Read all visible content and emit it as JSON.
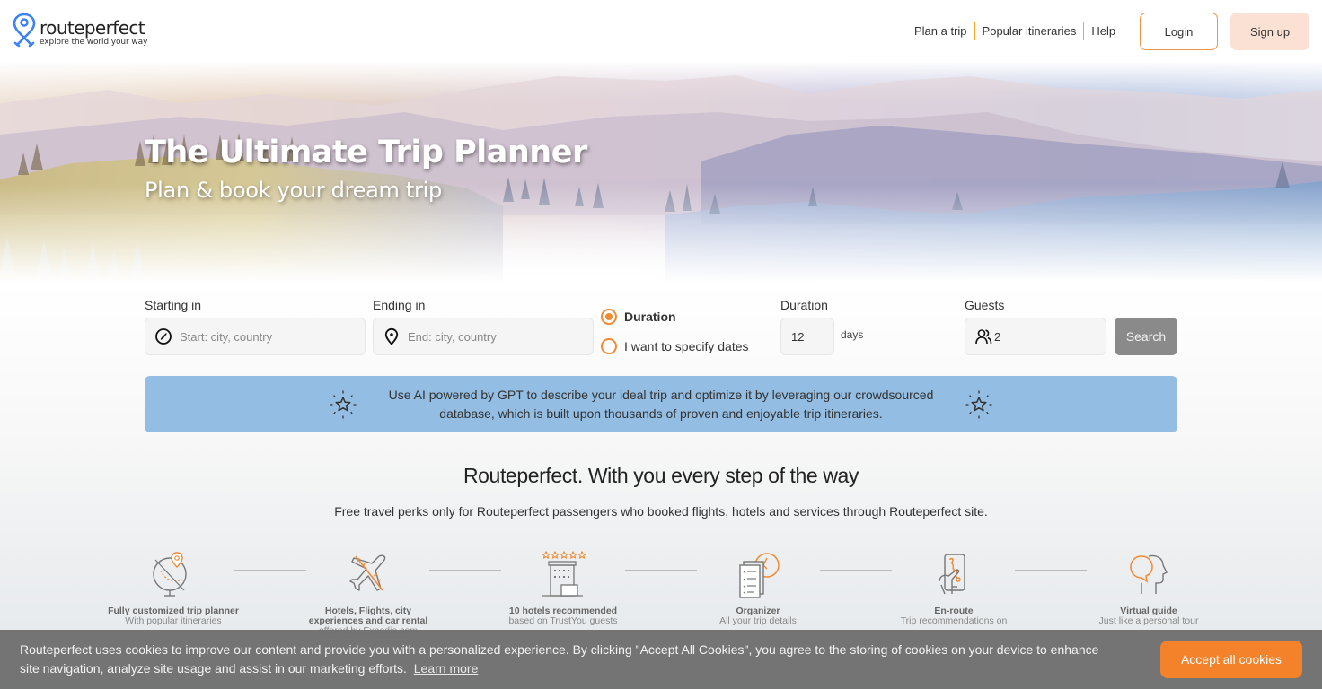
{
  "header": {
    "logo_name": "routeperfect",
    "logo_tagline": "explore the world your way",
    "nav": [
      {
        "label": "Plan a trip"
      },
      {
        "label": "Popular itineraries"
      },
      {
        "label": "Help"
      }
    ],
    "login_label": "Login",
    "signup_label": "Sign up"
  },
  "hero": {
    "title": "The Ultimate Trip Planner",
    "subtitle": "Plan & book your dream trip"
  },
  "search": {
    "start": {
      "label": "Starting in",
      "placeholder": "Start: city, country",
      "value": "",
      "icon": "compass-icon"
    },
    "end": {
      "label": "Ending in",
      "placeholder": "End: city, country",
      "value": "",
      "icon": "map-pin-icon"
    },
    "mode_options": [
      {
        "label": "Duration",
        "selected": true
      },
      {
        "label": "I want to specify dates",
        "selected": false
      }
    ],
    "duration": {
      "label": "Duration",
      "value": "12",
      "unit": "days"
    },
    "guests": {
      "label": "Guests",
      "value": "2",
      "icon": "users-icon"
    },
    "search_label": "Search"
  },
  "ai_banner": {
    "text": "Use AI powered by GPT to describe your ideal trip and optimize it by leveraging our crowdsourced database, which is built upon thousands of proven and enjoyable trip itineraries.",
    "icon": "sparkle-star-icon"
  },
  "perks": {
    "title": "Routeperfect. With you every step of the way",
    "subtitle": "Free travel perks only for Routeperfect passengers who booked flights, hotels and services through Routeperfect site.",
    "items": [
      {
        "icon": "globe-planner-icon",
        "title": "Fully customized trip planner",
        "desc": "With popular itineraries"
      },
      {
        "icon": "airplane-icon",
        "title": "Hotels, Flights, city experiences and car rental",
        "desc": "offered by Expedia.com"
      },
      {
        "icon": "hotel-icon",
        "title": "10 hotels recommended",
        "desc": "based on TrustYou guests"
      },
      {
        "icon": "organizer-icon",
        "title": "Organizer",
        "desc": "All your trip details"
      },
      {
        "icon": "phone-route-icon",
        "title": "En-route",
        "desc": "Trip recommendations on"
      },
      {
        "icon": "virtual-guide-icon",
        "title": "Virtual guide",
        "desc": "Just like a personal tour"
      }
    ]
  },
  "cookie": {
    "text": "Routeperfect uses cookies to improve our content and provide you with a personalized experience. By clicking \"Accept All Cookies\", you agree to the storing of cookies on your device to enhance site navigation, analyze site usage and assist in our marketing efforts.",
    "learn_more": "Learn more",
    "accept_label": "Accept all cookies"
  },
  "colors": {
    "accent": "#f28a33",
    "accept_button": "#f4822a",
    "logo_blue": "#3b82f6",
    "banner_blue": "#93bde2",
    "signup_bg": "#fbe1d3",
    "nav_separator": "#f5a623"
  }
}
